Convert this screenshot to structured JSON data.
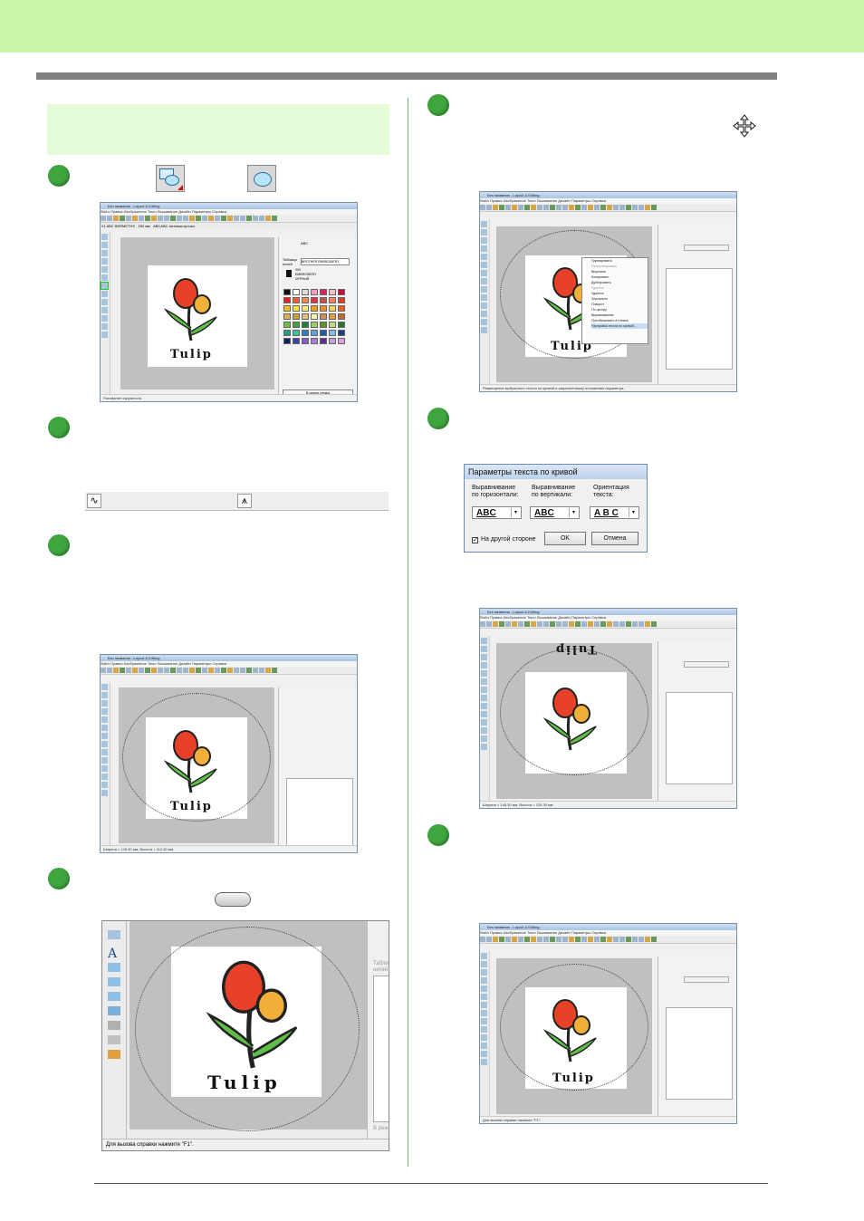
{
  "colors": {
    "header_band": "#c8f5a8",
    "rule": "#808080",
    "step_badge": "#3fa63f",
    "divider": "#6cc46c",
    "section_box": "#e6fbd8"
  },
  "icons": [
    "shape-tool-icon",
    "ellipse-icon",
    "move-cursor-icon",
    "stitch-line-icon",
    "stitch-zigzag-icon",
    "key-icon"
  ],
  "screenshots": {
    "window_title": "Без названия - Layout & Editing",
    "menu_items": [
      "Файл",
      "Правка",
      "Изображение",
      "Текст",
      "Вышивание",
      "Дизайн",
      "Параметры",
      "Справка"
    ],
    "tulip_text": "Tulip",
    "shot1": {
      "status": "Рисование окружность",
      "font_name": "01 ABC",
      "font_value": "BERMETHS",
      "size_value": "250",
      "size_unit": "мм",
      "thread_mode": "ABCABC Автовыстрочка",
      "tooltip": "Окружность",
      "panel_label": "Таблица нитей",
      "panel_value": "BROTHER EMBROIDERY",
      "thread_code": "900",
      "thread_name_1": "EMBROIDERY",
      "thread_name_2": "ЧЕРНЫЙ",
      "panel_button": "В режим стежка",
      "panel_tab": "ABC"
    },
    "shot2": {
      "status": "Размещение выбранного текста по кривой и закрепленному положению параметра.",
      "context_menu": [
        "Группировать",
        "Разгруппировать",
        "Вырезать",
        "Копировать",
        "Дублировать",
        "Удалить",
        "Удалить",
        "Зеркально",
        "Поворот",
        "По центру",
        "Выравнивание",
        "Преобразовать в стежки",
        "Настройка текста по кривой..."
      ]
    },
    "shot3": {
      "status": "Ширина = 145.30 мм, Высота = 112.80 мм"
    },
    "shot4": {
      "status": "Ширина = 145.30 мм, Высота = 129.30 мм"
    },
    "shot5": {
      "status": "Для вызова справки нажмите \"F1\"."
    },
    "zoom": {
      "status": "Для вызова справки нажмите \"F1\".",
      "panel_label_1": "Табли",
      "panel_label_2": "нитей",
      "panel_button": "В реж"
    }
  },
  "dialog": {
    "title": "Параметры текста по кривой",
    "col1_label_1": "Выравнивание",
    "col1_label_2": "по горизонтали:",
    "col2_label_1": "Выравнивание",
    "col2_label_2": "по вертикали:",
    "col3_label_1": "Ориентация",
    "col3_label_2": "текста:",
    "combo1": "ABC",
    "combo2": "ABC",
    "combo3": "A B C",
    "checkbox_label": "На другой стороне",
    "checkbox_checked": true,
    "ok_label": "OK",
    "cancel_label": "Отмена"
  }
}
